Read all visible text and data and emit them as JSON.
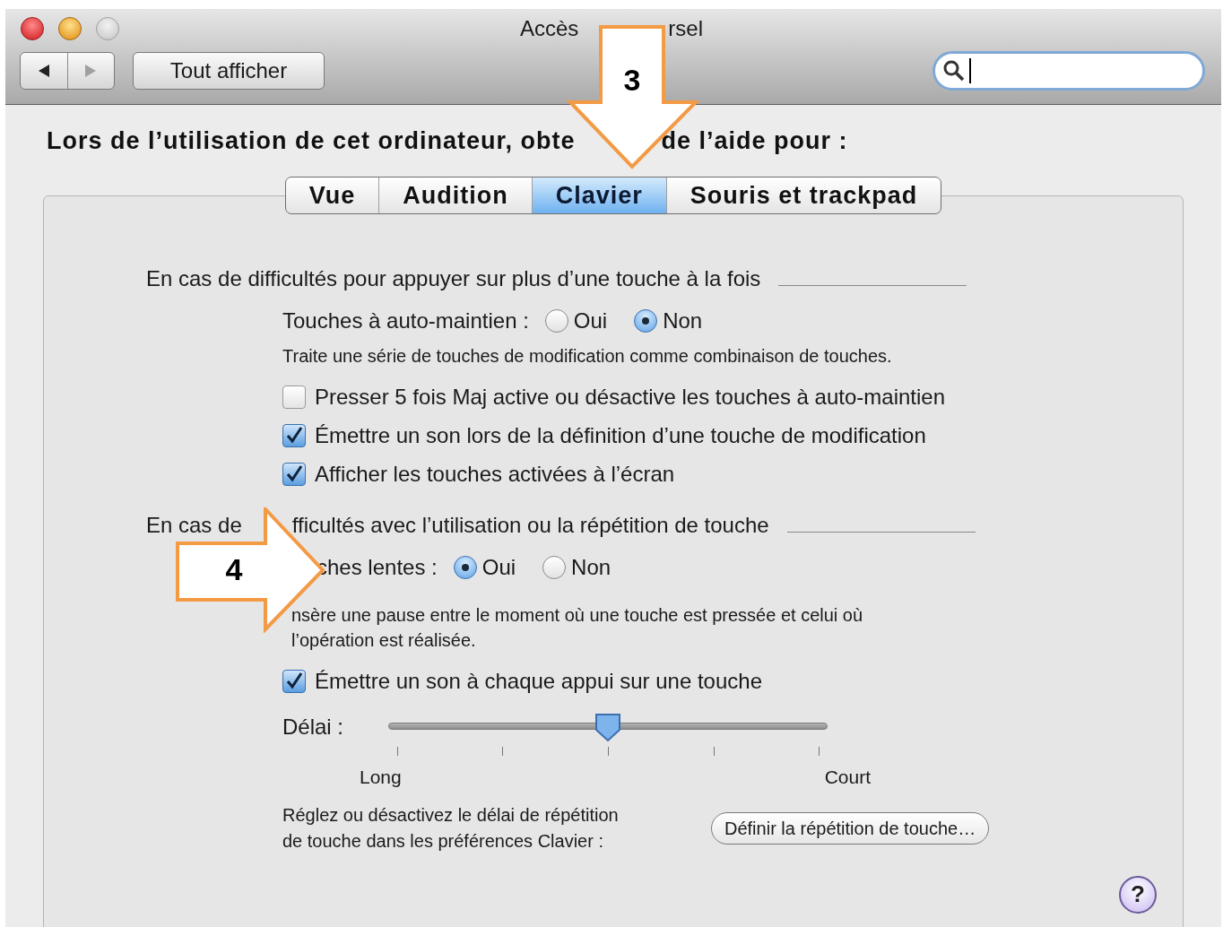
{
  "window": {
    "title_parts": [
      "Accès",
      "rsel"
    ]
  },
  "toolbar": {
    "show_all_button": "Tout afficher"
  },
  "heading_parts": [
    "Lors de l’utilisation de cet ordinateur, obte",
    "de l’aide pour :"
  ],
  "tabs": [
    {
      "label": "Vue",
      "selected": false
    },
    {
      "label": "Audition",
      "selected": false
    },
    {
      "label": "Clavier",
      "selected": true
    },
    {
      "label": "Souris et trackpad",
      "selected": false
    }
  ],
  "sections": [
    {
      "heading_parts": [
        "En cas de difficultés pour appuyer sur plus d’une touche à la fois"
      ],
      "items": [
        {
          "kind": "radio_group",
          "label": "Touches à auto-maintien :",
          "options": [
            {
              "label": "Oui",
              "selected": false
            },
            {
              "label": "Non",
              "selected": true
            }
          ]
        },
        {
          "kind": "hint",
          "text": "Traite une série de touches de modification comme combinaison de touches."
        },
        {
          "kind": "checkbox",
          "label": "Presser 5 fois Maj active ou désactive les touches à auto-maintien",
          "checked": false
        },
        {
          "kind": "checkbox",
          "label": "Émettre un son lors de la définition d’une touche de modification",
          "checked": true
        },
        {
          "kind": "checkbox",
          "label": "Afficher les touches activées à l’écran",
          "checked": true
        }
      ]
    },
    {
      "heading_parts": [
        "En cas de",
        "fficultés avec l’utilisation ou la répétition de touche"
      ],
      "items": [
        {
          "kind": "radio_group",
          "label": "ches lentes :",
          "options": [
            {
              "label": "Oui",
              "selected": true
            },
            {
              "label": "Non",
              "selected": false
            }
          ]
        },
        {
          "kind": "hint",
          "text": "nsère une pause entre le moment où une touche est pressée et celui où\nl’opération est réalisée."
        },
        {
          "kind": "checkbox",
          "label": "Émettre un son à chaque appui sur une touche",
          "checked": true
        },
        {
          "kind": "slider",
          "label": "Délai :",
          "level": 0.5,
          "min_label": "Long",
          "max_label": "Court"
        },
        {
          "kind": "button_row",
          "text": "Réglez ou désactivez le délai de répétition\nde touche dans les préférences Clavier :",
          "button": "Définir la répétition de touche…"
        }
      ]
    }
  ],
  "help_button": "?",
  "annotations": [
    {
      "number": "3",
      "kind": "down_arrow"
    },
    {
      "number": "4",
      "kind": "right_arrow"
    }
  ]
}
